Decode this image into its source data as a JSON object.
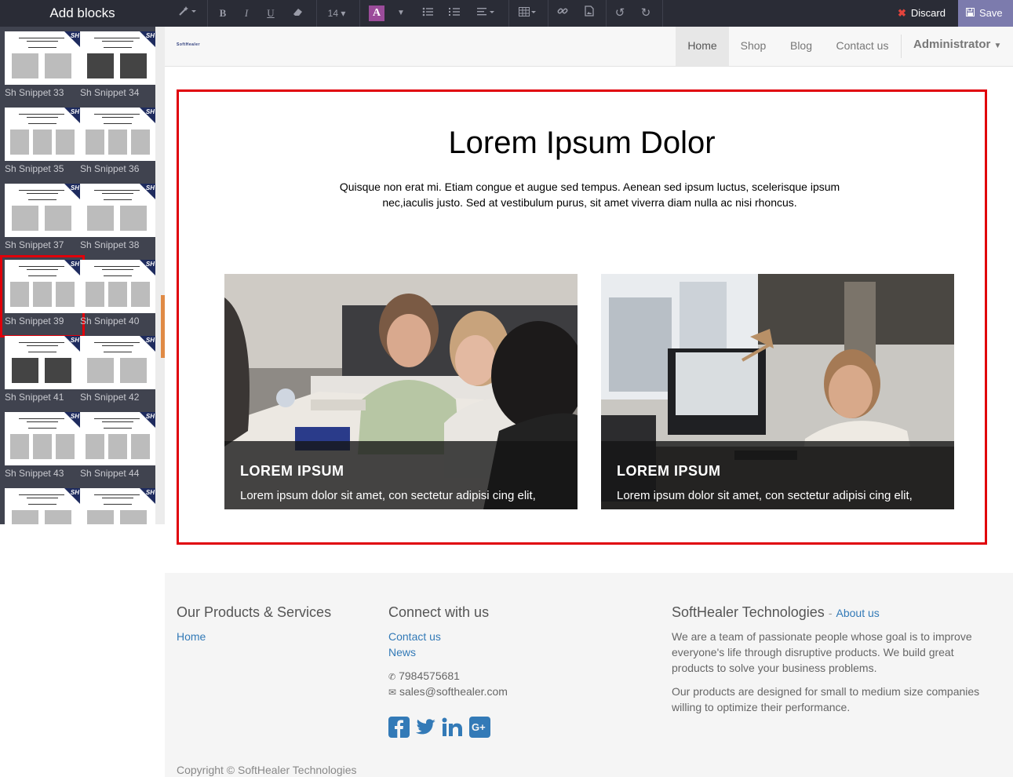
{
  "sidebar": {
    "title": "Add blocks",
    "badge": "SH",
    "snippets": [
      {
        "label": "Sh Snippet 33",
        "selected": false
      },
      {
        "label": "Sh Snippet 34",
        "selected": false
      },
      {
        "label": "Sh Snippet 35",
        "selected": false
      },
      {
        "label": "Sh Snippet 36",
        "selected": false
      },
      {
        "label": "Sh Snippet 37",
        "selected": false
      },
      {
        "label": "Sh Snippet 38",
        "selected": false
      },
      {
        "label": "Sh Snippet 39",
        "selected": true
      },
      {
        "label": "Sh Snippet 40",
        "selected": false
      },
      {
        "label": "Sh Snippet 41",
        "selected": false
      },
      {
        "label": "Sh Snippet 42",
        "selected": false
      },
      {
        "label": "Sh Snippet 43",
        "selected": false
      },
      {
        "label": "Sh Snippet 44",
        "selected": false
      },
      {
        "label": "",
        "selected": false
      },
      {
        "label": "",
        "selected": false
      }
    ]
  },
  "toolbar": {
    "font_size": "14",
    "color_letter": "A",
    "discard_label": "Discard",
    "save_label": "Save",
    "accent": "#7c7bad",
    "discard_icon_color": "#e2433c"
  },
  "header": {
    "logo_text": "SoftHealer",
    "nav": [
      {
        "label": "Home",
        "active": true
      },
      {
        "label": "Shop",
        "active": false
      },
      {
        "label": "Blog",
        "active": false
      },
      {
        "label": "Contact us",
        "active": false
      }
    ],
    "user": "Administrator"
  },
  "hero": {
    "title": "Lorem Ipsum Dolor",
    "text": "Quisque non erat mi. Etiam congue et augue sed tempus. Aenean sed ipsum luctus, scelerisque ipsum nec,iaculis justo. Sed at vestibulum purus, sit amet viverra diam nulla ac nisi rhoncus."
  },
  "cards": [
    {
      "title": "LOREM IPSUM",
      "text": "Lorem ipsum dolor sit amet, con sectetur adipisi cing elit,"
    },
    {
      "title": "LOREM IPSUM",
      "text": "Lorem ipsum dolor sit amet, con sectetur adipisi cing elit,"
    }
  ],
  "footer": {
    "products_title": "Our Products & Services",
    "products_links": [
      "Home"
    ],
    "connect_title": "Connect with us",
    "connect_links": [
      "Contact us",
      "News"
    ],
    "phone": "7984575681",
    "email": "sales@softhealer.com",
    "social_icons": [
      "facebook-icon",
      "twitter-icon",
      "linkedin-icon",
      "google-plus-icon"
    ],
    "company_title": "SoftHealer Technologies",
    "company_dash": "-",
    "about_link": "About us",
    "about_p1": "We are a team of passionate people whose goal is to improve everyone's life through disruptive products. We build great products to solve your business problems.",
    "about_p2": "Our products are designed for small to medium size companies willing to optimize their performance.",
    "copyright": "Copyright © SoftHealer Technologies"
  },
  "colors": {
    "selection": "#e0000a",
    "link": "#337ab7",
    "brand_badge": "#1e2b5e"
  }
}
